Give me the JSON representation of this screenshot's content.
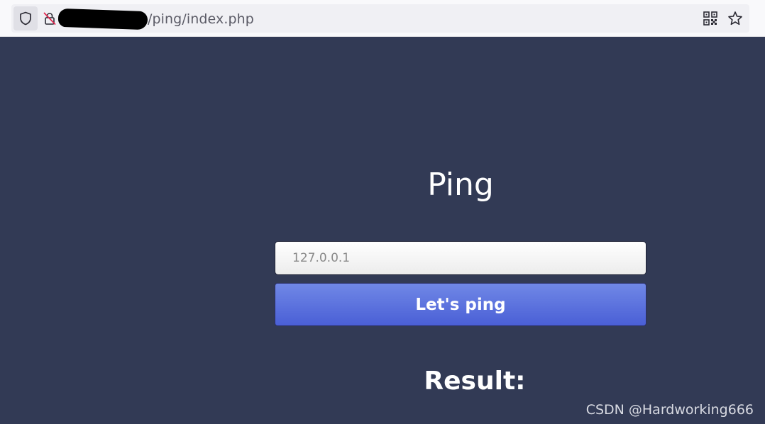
{
  "browser": {
    "url_visible_suffix": "/ping/index.php",
    "icons": {
      "shield": "shield-icon",
      "lock": "insecure-lock-icon",
      "qr": "qr-code-icon",
      "star": "bookmark-star-icon"
    }
  },
  "page": {
    "title": "Ping",
    "input": {
      "value": "",
      "placeholder": "127.0.0.1"
    },
    "button_label": "Let's ping",
    "result_label": "Result:",
    "background_color": "#323a55",
    "button_color": "#5b73e0"
  },
  "watermark": "CSDN @Hardworking666"
}
